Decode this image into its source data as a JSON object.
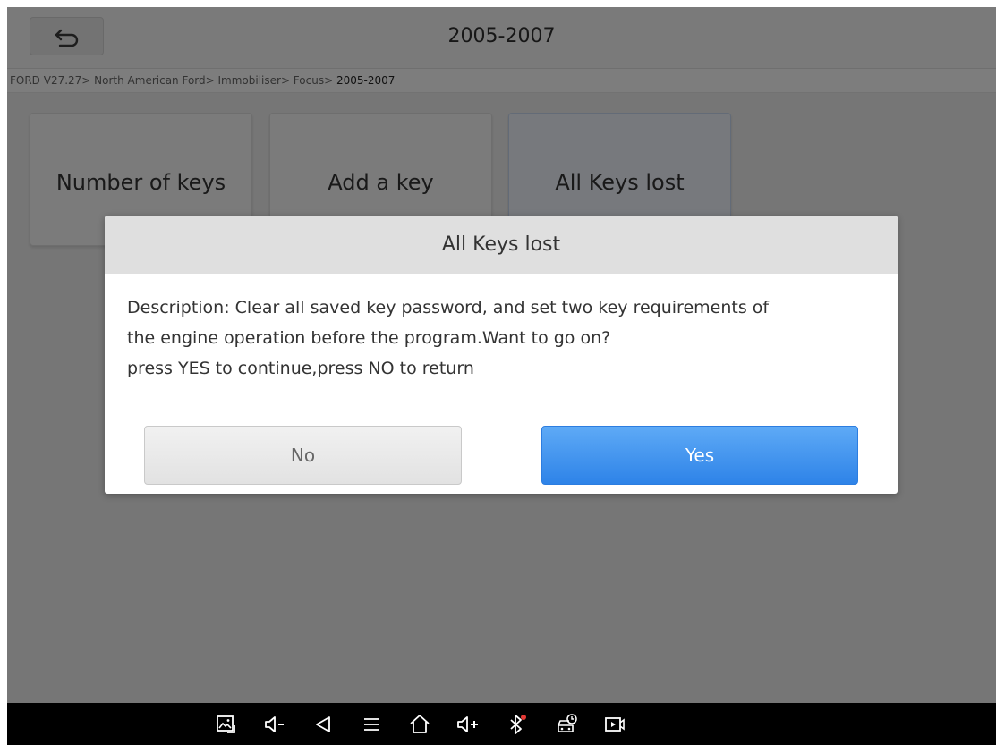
{
  "header": {
    "title": "2005-2007",
    "back_icon": "back-arrow-icon"
  },
  "breadcrumb": {
    "path": "FORD V27.27> North American Ford> Immobiliser> Focus> ",
    "current": "2005-2007"
  },
  "menu": {
    "tiles": [
      {
        "label": "Number of keys"
      },
      {
        "label": "Add a key"
      },
      {
        "label": "All Keys lost"
      }
    ]
  },
  "dialog": {
    "title": "All Keys lost",
    "line1": "Description: Clear all saved key password, and set two key requirements of",
    "line2": "the engine operation before the program.Want to go on?",
    "line3": "press YES to continue,press NO to return",
    "no_label": "No",
    "yes_label": "Yes"
  },
  "navbar": {
    "icons": [
      "screenshot-icon",
      "volume-down-icon",
      "back-icon",
      "menu-icon",
      "home-icon",
      "volume-up-icon",
      "bluetooth-icon",
      "vci-icon",
      "screen-record-icon"
    ]
  },
  "colors": {
    "accent": "#2e83e8",
    "overlay": "#777777"
  }
}
